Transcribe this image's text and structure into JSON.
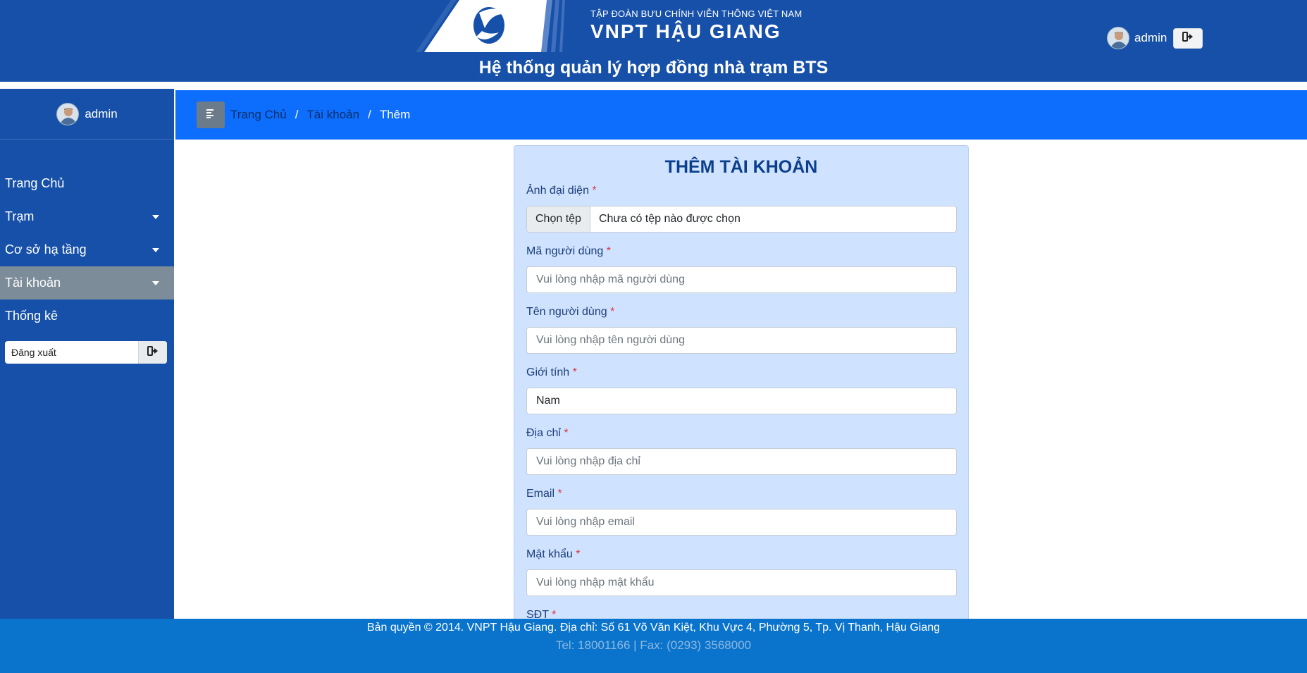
{
  "header": {
    "org_name": "TẬP ĐOÀN BƯU CHÍNH VIỄN THÔNG VIỆT NAM",
    "brand": "VNPT HẬU GIANG",
    "site_title": "Hệ thống quản lý hợp đồng nhà trạm BTS",
    "user_name": "admin",
    "logout_icon": "sign-out-icon"
  },
  "sidebar": {
    "user_name": "admin",
    "items": [
      {
        "label": "Trang Chủ",
        "has_caret": false,
        "active": false
      },
      {
        "label": "Trạm",
        "has_caret": true,
        "active": false
      },
      {
        "label": "Cơ sở hạ tầng",
        "has_caret": true,
        "active": false
      },
      {
        "label": "Tài khoản",
        "has_caret": true,
        "active": true
      },
      {
        "label": "Thống kê",
        "has_caret": false,
        "active": false
      }
    ],
    "logout_label": "Đăng xuất"
  },
  "breadcrumb": {
    "items": [
      "Trang Chủ",
      "Tài khoản"
    ],
    "current": "Thêm",
    "separator": "/"
  },
  "form": {
    "title": "THÊM TÀI KHOẢN",
    "required_marker": "*",
    "avatar": {
      "label": "Ảnh đại diện",
      "button": "Chọn tệp",
      "file_status": "Chưa có tệp nào được chọn"
    },
    "user_code": {
      "label": "Mã người dùng",
      "placeholder": "Vui lòng nhập mã người dùng"
    },
    "user_name": {
      "label": "Tên người dùng",
      "placeholder": "Vui lòng nhập tên người dùng"
    },
    "gender": {
      "label": "Giới tính",
      "value": "Nam"
    },
    "address": {
      "label": "Địa chỉ",
      "placeholder": "Vui lòng nhập địa chỉ"
    },
    "email": {
      "label": "Email",
      "placeholder": "Vui lòng nhập email"
    },
    "password": {
      "label": "Mật khẩu",
      "placeholder": "Vui lòng nhập mật khẩu"
    },
    "phone": {
      "label": "SĐT"
    }
  },
  "footer": {
    "copyright": "Bản quyền © 2014. VNPT Hậu Giang. Địa chỉ: Số 61 Võ Văn Kiệt, Khu Vực 4, Phường 5, Tp. Vị Thanh, Hậu Giang",
    "contact": "Tel: 18001166 | Fax: (0293) 3568000"
  },
  "colors": {
    "header_bg": "#1650a8",
    "breadcrumb_bg": "#0d6efd",
    "card_bg": "#cfe2ff",
    "active_item_bg": "#7d8c99",
    "footer_bg": "#0a74cc",
    "required": "#dc3545"
  }
}
